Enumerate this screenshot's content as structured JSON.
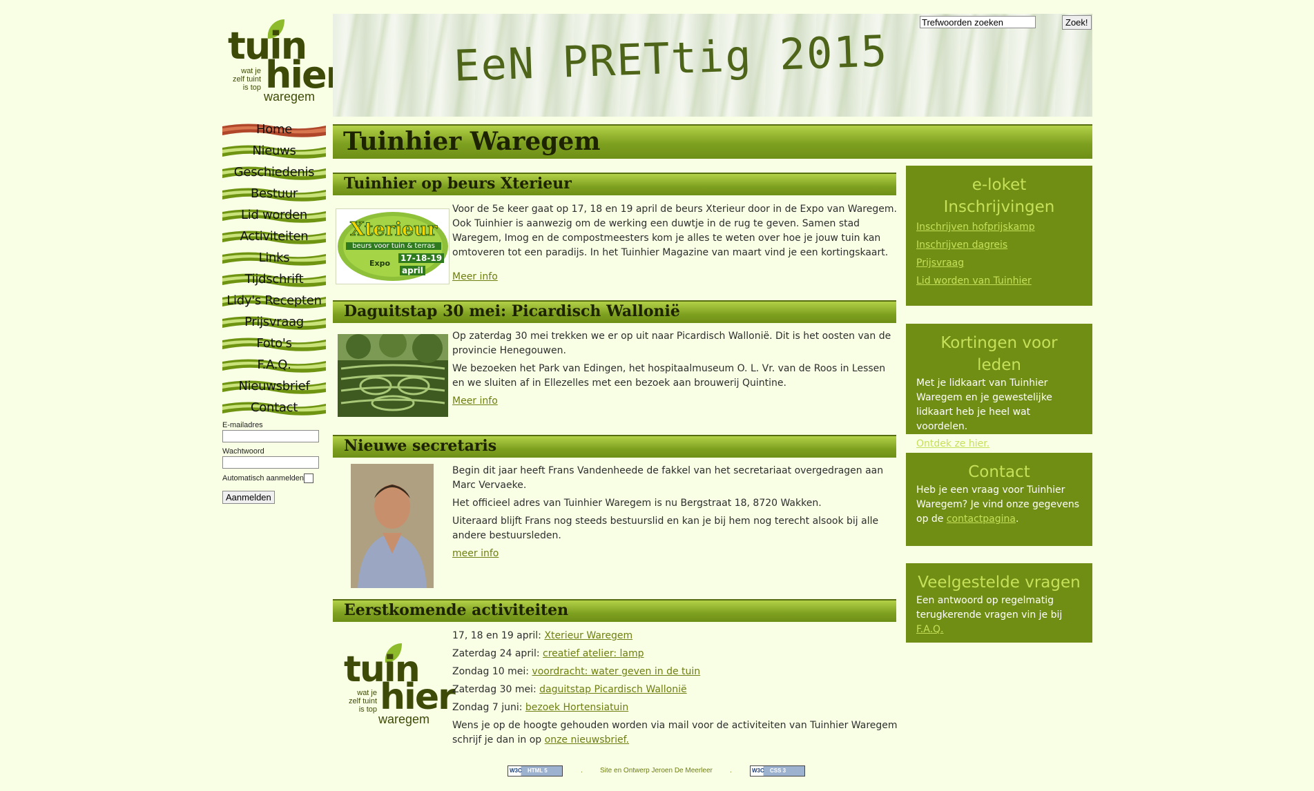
{
  "logo": {
    "line1": "tuin",
    "line2": "hier",
    "tagline": [
      "wat je",
      "zelf tuint",
      "is top"
    ],
    "place": "waregem"
  },
  "banner": {
    "text": "EeN PRETtig 2015"
  },
  "search": {
    "value": "Trefwoorden zoeken",
    "button": "Zoek!"
  },
  "nav": {
    "items": [
      "Home",
      "Nieuws",
      "Geschiedenis",
      "Bestuur",
      "Lid worden",
      "Activiteiten",
      "Links",
      "Tijdschrift",
      "Lidy's Recepten",
      "Prijsvraag",
      "Foto's",
      "F.A.Q.",
      "Nieuwsbrief",
      "Contact"
    ],
    "active": "Home"
  },
  "login": {
    "email_label": "E-mailadres",
    "password_label": "Wachtwoord",
    "remember_label": "Automatisch aanmelden",
    "submit": "Aanmelden"
  },
  "page": {
    "title": "Tuinhier Waregem"
  },
  "articles": [
    {
      "title": "Tuinhier op beurs Xterieur",
      "image": {
        "word": "Xterieur",
        "sub": "beurs voor tuin & terras",
        "expo": "Expo",
        "dates": "17-18-19",
        "month": "april"
      },
      "paragraphs": [
        "Voor de 5e keer gaat op 17, 18 en 19 april de beurs Xterieur door in de Expo van Waregem. Ook Tuinhier is aanwezig om de werking een duwtje in de rug te geven. Samen stad Waregem, Imog en de compostmeesters kom je alles te weten over hoe je jouw tuin kan omtoveren tot een paradijs. In het Tuinhier Magazine van maart vind je een kortingskaart."
      ],
      "more": "Meer info"
    },
    {
      "title": "Daguitstap 30 mei: Picardisch Wallonië",
      "paragraphs": [
        "Op zaterdag 30 mei trekken we er op uit naar Picardisch Wallonië. Dit is het oosten van de provincie Henegouwen.",
        "We bezoeken het Park van Edingen, het hospitaalmuseum O. L. Vr. van de Roos in Lessen en we sluiten af in Ellezelles met een bezoek aan brouwerij Quintine."
      ],
      "more": "Meer info"
    },
    {
      "title": "Nieuwe secretaris",
      "paragraphs": [
        "Begin dit jaar heeft Frans Vandenheede de fakkel van het secretariaat overgedragen aan Marc Vervaeke.",
        "Het officieel adres van Tuinhier Waregem is nu Bergstraat 18, 8720 Wakken.",
        "Uiteraard blijft Frans nog steeds bestuurslid en kan je bij hem nog terecht alsook bij alle andere bestuursleden."
      ],
      "more": "meer info"
    },
    {
      "title": "Eerstkomende activiteiten",
      "events": [
        {
          "date": "17, 18 en 19 april:",
          "link": "Xterieur Waregem"
        },
        {
          "date": "Zaterdag 24 april:",
          "link": "creatief atelier: lamp"
        },
        {
          "date": "Zondag 10 mei:",
          "link": "voordracht: water geven in de tuin"
        },
        {
          "date": "Zaterdag 30 mei:",
          "link": "daguitstap Picardisch Wallonië"
        },
        {
          "date": "Zondag 7 juni:",
          "link": "bezoek Hortensiatuin"
        }
      ],
      "outro": "Wens je op de hoogte gehouden worden via mail voor de activiteiten van Tuinhier Waregem schrijf je dan in op",
      "outro_link": "onze nieuwsbrief."
    }
  ],
  "sidebar": {
    "eloket": {
      "title_line1": "e-loket",
      "title_line2": "Inschrijvingen",
      "links": [
        "Inschrijven hofprijskamp",
        "Inschrijven dagreis",
        "Prijsvraag",
        "Lid worden van Tuinhier"
      ]
    },
    "kortingen": {
      "title": "Kortingen voor leden",
      "text": "Met je lidkaart van Tuinhier Waregem en je gewestelijke lidkaart heb je heel wat voordelen.",
      "link": "Ontdek ze hier."
    },
    "contact": {
      "title": "Contact",
      "text": "Heb je een vraag voor Tuinhier Waregem? Je vind onze gegevens op de",
      "link": "contactpagina",
      "after": "."
    },
    "faq": {
      "title": "Veelgestelde vragen",
      "text": "Een antwoord op regelmatig terugkerende vragen vin je bij",
      "link": "F.A.Q."
    }
  },
  "footer": {
    "credit": "Site en Ontwerp Jeroen De Meerleer",
    "badge_html": "HTML 5",
    "badge_css": "CSS 3",
    "badge_w3c": "W3C",
    "sep": "."
  },
  "colors": {
    "background": "#f8ffe4",
    "accent": "#6f8e13",
    "accent_light": "#c6e05a",
    "nav_active": "#b0472b",
    "link": "#6f7e10"
  }
}
